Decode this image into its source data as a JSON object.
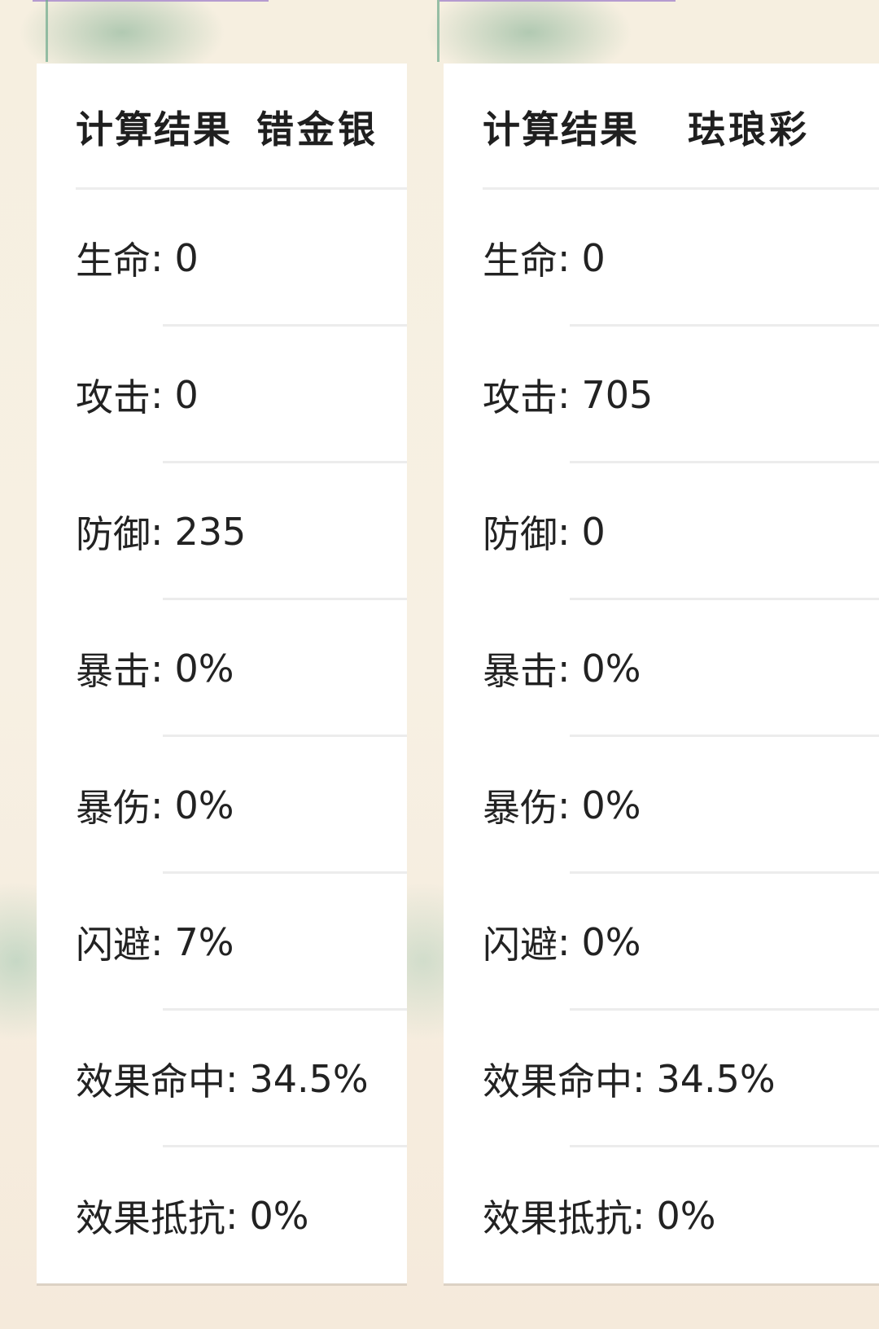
{
  "cards": [
    {
      "title": "计算结果",
      "name": "错金银",
      "stats": [
        {
          "label": "生命",
          "value": "0"
        },
        {
          "label": "攻击",
          "value": "0"
        },
        {
          "label": "防御",
          "value": "235"
        },
        {
          "label": "暴击",
          "value": "0%"
        },
        {
          "label": "暴伤",
          "value": "0%"
        },
        {
          "label": "闪避",
          "value": "7%"
        },
        {
          "label": "效果命中",
          "value": "34.5%"
        },
        {
          "label": "效果抵抗",
          "value": "0%"
        }
      ]
    },
    {
      "title": "计算结果",
      "name": "珐琅彩",
      "stats": [
        {
          "label": "生命",
          "value": "0"
        },
        {
          "label": "攻击",
          "value": "705"
        },
        {
          "label": "防御",
          "value": "0"
        },
        {
          "label": "暴击",
          "value": "0%"
        },
        {
          "label": "暴伤",
          "value": "0%"
        },
        {
          "label": "闪避",
          "value": "0%"
        },
        {
          "label": "效果命中",
          "value": "34.5%"
        },
        {
          "label": "效果抵抗",
          "value": "0%"
        }
      ]
    }
  ],
  "separator": ":"
}
